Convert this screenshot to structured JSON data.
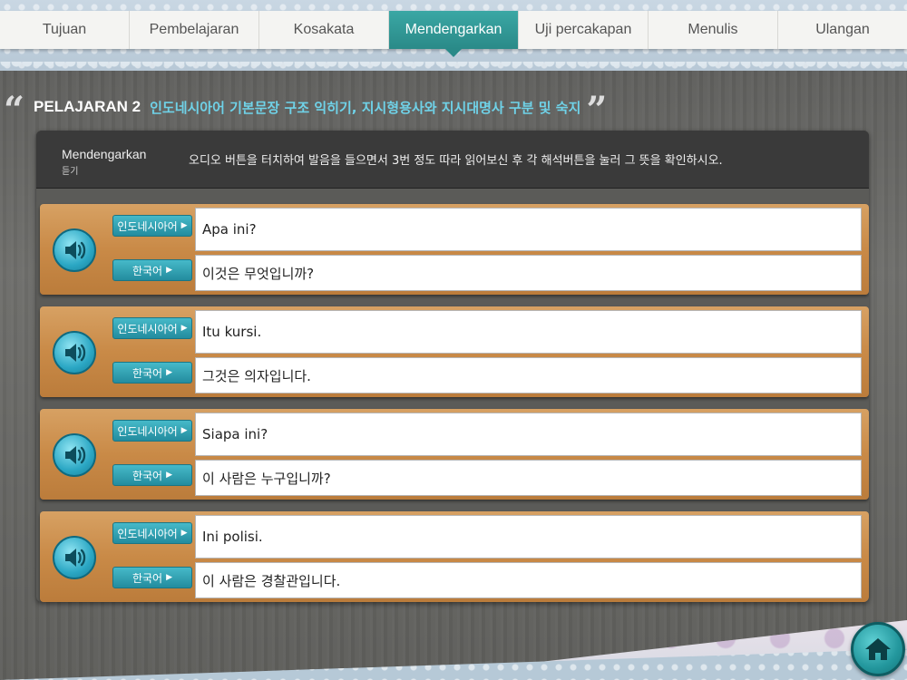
{
  "tabs": [
    {
      "label": "Tujuan",
      "active": false
    },
    {
      "label": "Pembelajaran",
      "active": false
    },
    {
      "label": "Kosakata",
      "active": false
    },
    {
      "label": "Mendengarkan",
      "active": true
    },
    {
      "label": "Uji percakapan",
      "active": false
    },
    {
      "label": "Menulis",
      "active": false
    },
    {
      "label": "Ulangan",
      "active": false
    }
  ],
  "lesson": {
    "number": "PELAJARAN 2",
    "title": "인도네시아어 기본문장 구조 익히기, 지시형용사와 지시대명사 구분 및 숙지"
  },
  "instruction": {
    "label": "Mendengarkan",
    "label_ko": "듣기",
    "text": "오디오 버튼을 터치하여 발음을 들으면서 3번 정도 따라 읽어보신 후 각 해석버튼을 눌러 그 뜻을 확인하시오."
  },
  "lang_buttons": {
    "indonesian": "인도네시아어",
    "korean": "한국어"
  },
  "items": [
    {
      "indonesian": "Apa ini?",
      "korean": "이것은 무엇입니까?"
    },
    {
      "indonesian": "Itu kursi.",
      "korean": "그것은 의자입니다."
    },
    {
      "indonesian": "Siapa ini?",
      "korean": "이 사람은 누구입니까?"
    },
    {
      "indonesian": "Ini polisi.",
      "korean": "이 사람은 경찰관입니다."
    }
  ],
  "icons": {
    "speaker": "speaker-icon",
    "home": "home-icon",
    "arrow": "play-arrow-icon"
  },
  "colors": {
    "accent": "#2a8a88",
    "title_text": "#6fd2e8"
  }
}
